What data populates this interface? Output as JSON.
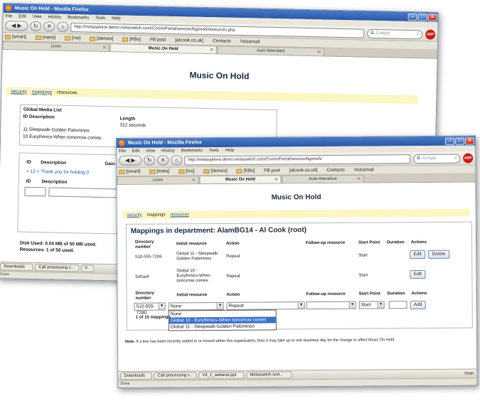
{
  "back_window": {
    "title": "Music On Hold - Mozilla Firefox",
    "menu": [
      "File",
      "Edit",
      "View",
      "History",
      "Bookmarks",
      "Tools",
      "Help"
    ],
    "url": "http://metasphere.demo.metaswitch.com/CommPortal/session/bg/moh/resources.php",
    "search_placeholder": "Google",
    "bookmarks": [
      "[smart]",
      "[meta]",
      "[rss]",
      "[demos]",
      "[KBs]",
      "FB post",
      "[alcook.co.uk]",
      "Contacts",
      "Voicemail"
    ],
    "tabs": [
      "Lines",
      "Music On Hold",
      "Auto Attendant"
    ],
    "page_title": "Music On Hold",
    "nav": {
      "security": "security",
      "mappings": "mappings",
      "resources": "resources"
    },
    "global_media": {
      "heading": "Global Media List",
      "col_id_desc": "ID Description",
      "col_length": "Length",
      "length_value": "312 seconds",
      "rows": [
        "11 Sleepwalk-Golden Palominos",
        "10 Eurythmics-When tomorrow comes"
      ]
    },
    "dept_table": {
      "col_id": "ID",
      "col_desc": "Description",
      "col_gain": "Gain",
      "row": "> 12 > Thank you for holding 0",
      "col_id2": "ID",
      "col_desc2": "Description"
    },
    "disk_used": "Disk Used: 0.04 MB of 50 MB used.",
    "resources_used": "Resources: 1 of 50 used.",
    "taskbar": [
      "Downloads",
      "Call processing c...",
      "V"
    ],
    "status": "Done"
  },
  "front_window": {
    "title": "Music On Hold - Mozilla Firefox",
    "menu": [
      "File",
      "Edit",
      "View",
      "History",
      "Bookmarks",
      "Tools",
      "Help"
    ],
    "url": "http://metasphere.demo.metaswitch.com/CommPortal/session/bg/moh/",
    "search_placeholder": "Google",
    "bookmarks": [
      "[smart]",
      "[meta]",
      "[rss]",
      "[demos]",
      "[KBs]",
      "FB post",
      "[alcook.co.uk]",
      "Contacts",
      "Voicemail"
    ],
    "tabs": [
      "Lines",
      "Music On Hold",
      "Auto Attendant"
    ],
    "page_title": "Music On Hold",
    "nav": {
      "security": "security",
      "mappings": "mappings",
      "resources": "resources"
    },
    "heading": "Mappings in department: AlamBG14 - Al Cook (root)",
    "columns": {
      "dir_number": "Directory number",
      "initial_resource": "Initial resource",
      "action": "Action",
      "followup": "Follow-up resource",
      "start_point": "Start Point",
      "duration": "Duration",
      "actions": "Actions"
    },
    "rows": [
      {
        "dn": "510-555-7206",
        "initial": "Global 11 - Sleepwalk-Golden Palominos",
        "action": "Repeat",
        "start": "Start",
        "edit": "Edit",
        "delete": "Delete"
      },
      {
        "dn": "Default",
        "initial": "Global 10 - Eurythmics-When tomorrow comes",
        "action": "Repeat",
        "start": "Start",
        "edit": "Edit"
      }
    ],
    "new_row": {
      "dn_value": "510-555-7280",
      "initial_value": "None",
      "action_value": "Repeat",
      "followup_value": "",
      "start_value": "Start",
      "add": "Add"
    },
    "dropdown_options": [
      "None",
      "Global 10 - Eurythmics-When tomorrow comes",
      "Global 11 - Sleepwalk-Golden Palominos"
    ],
    "mapping_count": "1 of 15 mappings",
    "note_label": "Note:",
    "note": "If a line has been recently added to or moved within this organization, then it may take up to one business day for the change to affect Music On Hold.",
    "taskbar": [
      "Downloads",
      "Call processing c...",
      "V4_1_webinar.ppt",
      "Metaswitch-sort..."
    ],
    "status": "Done",
    "clear": "Clear"
  }
}
